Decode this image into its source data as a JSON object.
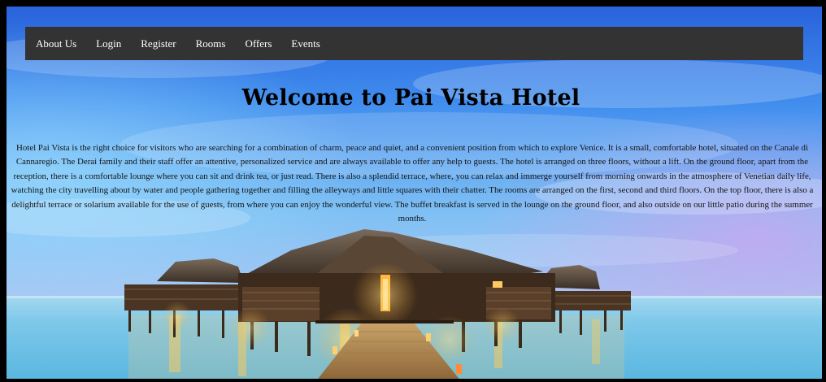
{
  "nav": {
    "items": [
      {
        "label": "About Us"
      },
      {
        "label": "Login"
      },
      {
        "label": "Register"
      },
      {
        "label": "Rooms"
      },
      {
        "label": "Offers"
      },
      {
        "label": "Events"
      }
    ]
  },
  "hero": {
    "title": "Welcome to Pai Vista Hotel",
    "description": "Hotel Pai Vista is the right choice for visitors who are searching for a combination of charm, peace and quiet, and a convenient position from which to explore Venice. It is a small, comfortable hotel, situated on the Canale di Cannaregio. The Derai family and their staff offer an attentive, personalized service and are always available to offer any help to guests. The hotel is arranged on three floors, without a lift. On the ground floor, apart from the reception, there is a comfortable lounge where you can sit and drink tea, or just read. There is also a splendid terrace, where, you can relax and immerge yourself from morning onwards in the atmosphere of Venetian daily life, watching the city travelling about by water and people gathering together and filling the alleyways and little squares with their chatter. The rooms are arranged on the first, second and third floors. On the top floor, there is also a delightful terrace or solarium available for the use of guests, from where you can enjoy the wonderful view. The buffet breakfast is served in the lounge on the ground floor, and also outside on our little patio during the summer months."
  },
  "colors": {
    "navbar_bg": "#333333",
    "nav_text": "#ffffff",
    "sky_top": "#2f6fe0",
    "water": "#6fc6ea"
  }
}
